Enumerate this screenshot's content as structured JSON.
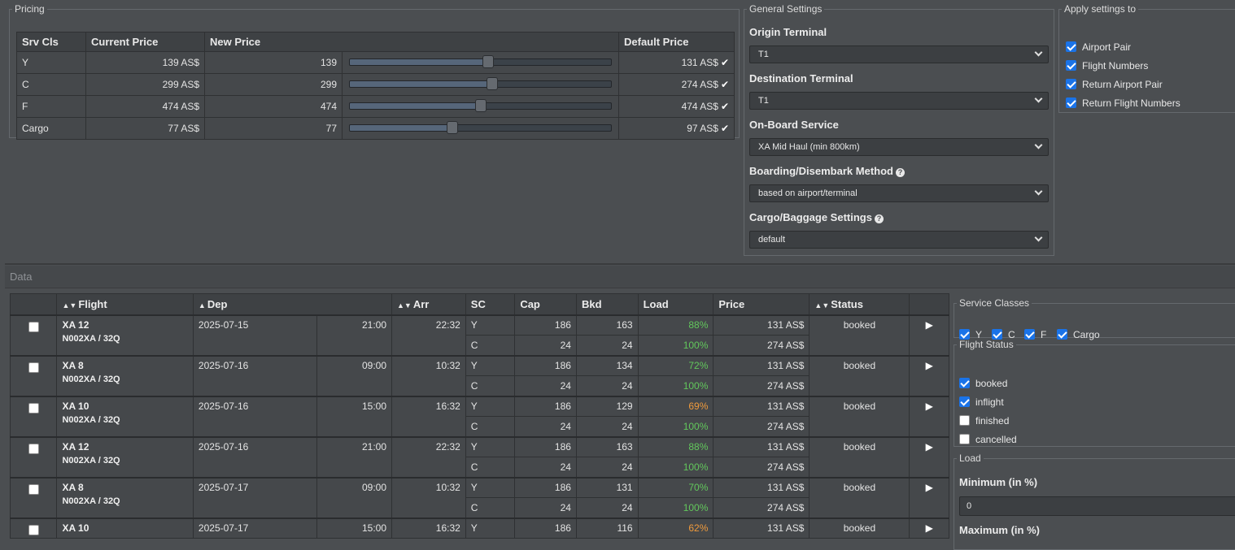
{
  "pricing": {
    "legend": "Pricing",
    "headers": [
      "Srv Cls",
      "Current Price",
      "New Price",
      "Default Price"
    ],
    "rows": [
      {
        "cls": "Y",
        "current": "139 AS$",
        "new": "139",
        "slider": 0.53,
        "default": "131 AS$"
      },
      {
        "cls": "C",
        "current": "299 AS$",
        "new": "299",
        "slider": 0.545,
        "default": "274 AS$"
      },
      {
        "cls": "F",
        "current": "474 AS$",
        "new": "474",
        "slider": 0.5,
        "default": "474 AS$"
      },
      {
        "cls": "Cargo",
        "current": "77 AS$",
        "new": "77",
        "slider": 0.395,
        "default": "97 AS$"
      }
    ],
    "check_icon": "check-icon"
  },
  "general": {
    "legend": "General Settings",
    "origin_label": "Origin Terminal",
    "origin_value": "T1",
    "dest_label": "Destination Terminal",
    "dest_value": "T1",
    "onboard_label": "On-Board Service",
    "onboard_value": "XA Mid Haul (min 800km)",
    "boarding_label": "Boarding/Disembark Method",
    "boarding_value": "based on airport/terminal",
    "cargo_label": "Cargo/Baggage Settings",
    "cargo_value": "default"
  },
  "apply": {
    "legend": "Apply settings to",
    "options": [
      {
        "label": "Airport Pair",
        "checked": true
      },
      {
        "label": "Flight Numbers",
        "checked": true
      },
      {
        "label": "Return Airport Pair",
        "checked": true
      },
      {
        "label": "Return Flight Numbers",
        "checked": true
      }
    ]
  },
  "data": {
    "title": "Data",
    "headers": {
      "flight": "Flight",
      "dep": "Dep",
      "arr": "Arr",
      "sc": "SC",
      "cap": "Cap",
      "bkd": "Bkd",
      "load": "Load",
      "price": "Price",
      "status": "Status"
    },
    "flights": [
      {
        "flight": "XA 12",
        "aircraft": "N002XA / 32Q",
        "date": "2025-07-15",
        "dep": "21:00",
        "arr": "22:32",
        "status": "booked",
        "classes": [
          {
            "sc": "Y",
            "cap": "186",
            "bkd": "163",
            "load": "88%",
            "price": "131 AS$"
          },
          {
            "sc": "C",
            "cap": "24",
            "bkd": "24",
            "load": "100%",
            "price": "274 AS$"
          }
        ]
      },
      {
        "flight": "XA 8",
        "aircraft": "N002XA / 32Q",
        "date": "2025-07-16",
        "dep": "09:00",
        "arr": "10:32",
        "status": "booked",
        "classes": [
          {
            "sc": "Y",
            "cap": "186",
            "bkd": "134",
            "load": "72%",
            "price": "131 AS$"
          },
          {
            "sc": "C",
            "cap": "24",
            "bkd": "24",
            "load": "100%",
            "price": "274 AS$"
          }
        ]
      },
      {
        "flight": "XA 10",
        "aircraft": "N002XA / 32Q",
        "date": "2025-07-16",
        "dep": "15:00",
        "arr": "16:32",
        "status": "booked",
        "classes": [
          {
            "sc": "Y",
            "cap": "186",
            "bkd": "129",
            "load": "69%",
            "price": "131 AS$"
          },
          {
            "sc": "C",
            "cap": "24",
            "bkd": "24",
            "load": "100%",
            "price": "274 AS$"
          }
        ]
      },
      {
        "flight": "XA 12",
        "aircraft": "N002XA / 32Q",
        "date": "2025-07-16",
        "dep": "21:00",
        "arr": "22:32",
        "status": "booked",
        "classes": [
          {
            "sc": "Y",
            "cap": "186",
            "bkd": "163",
            "load": "88%",
            "price": "131 AS$"
          },
          {
            "sc": "C",
            "cap": "24",
            "bkd": "24",
            "load": "100%",
            "price": "274 AS$"
          }
        ]
      },
      {
        "flight": "XA 8",
        "aircraft": "N002XA / 32Q",
        "date": "2025-07-17",
        "dep": "09:00",
        "arr": "10:32",
        "status": "booked",
        "classes": [
          {
            "sc": "Y",
            "cap": "186",
            "bkd": "131",
            "load": "70%",
            "price": "131 AS$"
          },
          {
            "sc": "C",
            "cap": "24",
            "bkd": "24",
            "load": "100%",
            "price": "274 AS$"
          }
        ]
      },
      {
        "flight": "XA 10",
        "aircraft": "",
        "date": "2025-07-17",
        "dep": "15:00",
        "arr": "16:32",
        "status": "booked",
        "classes": [
          {
            "sc": "Y",
            "cap": "186",
            "bkd": "116",
            "load": "62%",
            "price": "131 AS$"
          }
        ]
      }
    ]
  },
  "filters": {
    "service_legend": "Service Classes",
    "service_classes": [
      {
        "label": "Y",
        "checked": true
      },
      {
        "label": "C",
        "checked": true
      },
      {
        "label": "F",
        "checked": true
      },
      {
        "label": "Cargo",
        "checked": true
      }
    ],
    "status_legend": "Flight Status",
    "statuses": [
      {
        "label": "booked",
        "checked": true
      },
      {
        "label": "inflight",
        "checked": true
      },
      {
        "label": "finished",
        "checked": false
      },
      {
        "label": "cancelled",
        "checked": false
      }
    ],
    "load_legend": "Load",
    "min_label": "Minimum (in %)",
    "min_value": "0",
    "max_label": "Maximum (in %)"
  },
  "colors": {
    "good_load": "#62c75c",
    "mid_load": "#ef9a3c",
    "checkbox": "#1a73e8"
  }
}
